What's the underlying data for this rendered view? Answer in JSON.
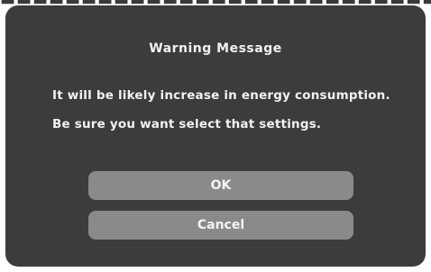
{
  "dialog": {
    "title": "Warning Message",
    "message_line1": "It will be likely increase in energy consumption.",
    "message_line2": "Be sure you want select that settings.",
    "ok_label": "OK",
    "cancel_label": "Cancel"
  },
  "colors": {
    "dialog_bg": "#3c3c3c",
    "button_bg": "#8a8a8a",
    "text": "#f2f2f2"
  }
}
